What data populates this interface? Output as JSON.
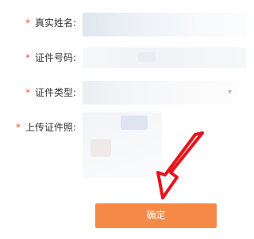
{
  "form": {
    "required_mark": "*",
    "name_label": "真实姓名:",
    "id_number_label": "证件号码:",
    "id_type_label": "证件类型:",
    "upload_label": "上传证件照:"
  },
  "actions": {
    "confirm_label": "确定"
  },
  "colors": {
    "required": "#e8542e",
    "button": "#f58a48",
    "annotation_arrow": "#e5141d"
  }
}
